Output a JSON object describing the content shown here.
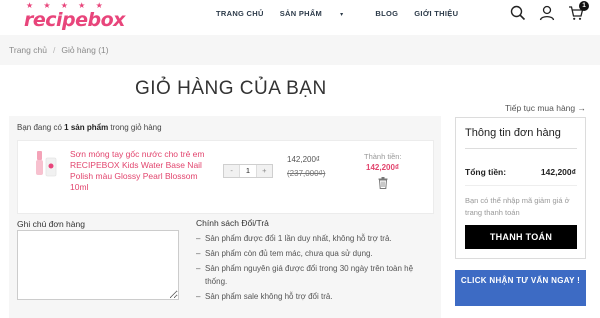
{
  "header": {
    "stars": "★ ★ ★ ★ ★",
    "logo": "recipebox",
    "nav": [
      {
        "label": "TRANG CHỦ"
      },
      {
        "label": "SẢN PHẨM",
        "has_dropdown": true
      },
      {
        "label": "BLOG"
      },
      {
        "label": "GIỚI THIỆU"
      }
    ],
    "icons": [
      "search-icon",
      "user-icon",
      "cart-icon"
    ],
    "cart_badge": "1"
  },
  "breadcrumb": {
    "home": "Trang chủ",
    "separator": "/",
    "current": "Giỏ hàng (1)"
  },
  "page": {
    "title": "GIỎ HÀNG CỦA BẠN",
    "continue_link": "Tiếp tục mua hàng →"
  },
  "cart": {
    "count_prefix": "Bạn đang có",
    "count_bold": "1 sản phẩm",
    "count_suffix": "trong giỏ hàng",
    "item": {
      "name": "Sơn móng tay gốc nước cho trẻ em RECIPEBOX Kids Water Base Nail Polish màu Glossy Pearl Blossom 10ml",
      "qty_minus": "-",
      "qty": "1",
      "qty_plus": "+",
      "price": "142,200₫",
      "old_price": "(237,000₫)",
      "total_label": "Thành tiền:",
      "total": "142,200₫"
    },
    "note_label": "Ghi chú đơn hàng",
    "policy_title": "Chính sách Đổi/Trả",
    "policies": [
      "Sản phẩm được đổi 1 lần duy nhất, không hỗ trợ trả.",
      "Sản phẩm còn đủ tem mác, chưa qua sử dụng.",
      "Sản phẩm nguyên giá được đổi trong 30 ngày trên toàn hệ thống.",
      "Sản phẩm sale không hỗ trợ đổi trả."
    ]
  },
  "order": {
    "title": "Thông tin đơn hàng",
    "total_label": "Tổng tiền:",
    "total": "142,200₫",
    "note": "Bạn có thể nhập mã giảm giá ở trang thanh toán",
    "checkout": "THANH TOÁN",
    "consult": "CLICK NHẬN TƯ VẤN NGAY !"
  },
  "colors": {
    "brand_pink": "#e8457b",
    "price_pink": "#e2456e",
    "consult_blue": "#3d6bc4",
    "checkout_black": "#000000"
  }
}
